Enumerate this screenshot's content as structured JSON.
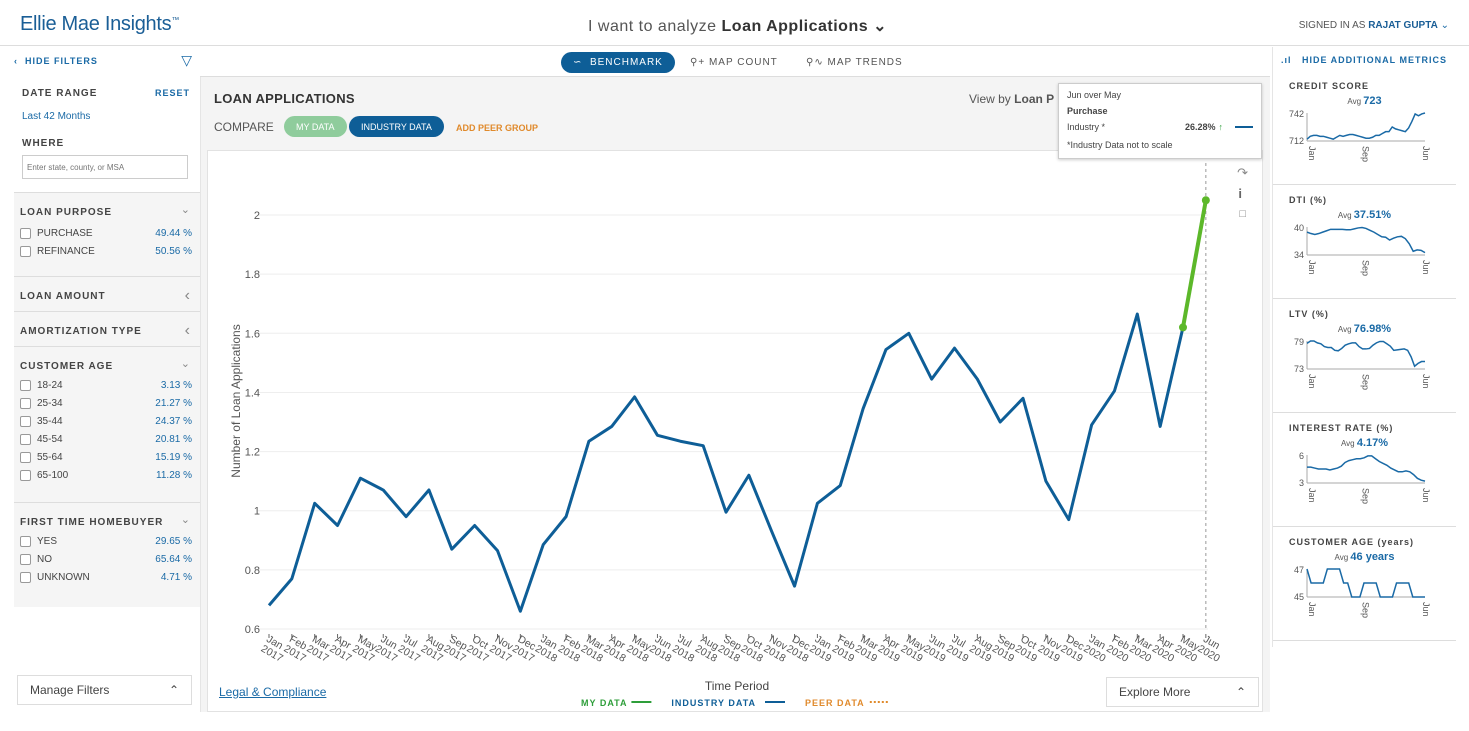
{
  "header": {
    "logo": "Ellie Mae Insights",
    "logo_tm": "™",
    "analyze_prefix": "I want to analyze",
    "analyze_subject": "Loan Applications",
    "signed_prefix": "SIGNED IN AS",
    "user": "RAJAT GUPTA"
  },
  "filters": {
    "hide": "HIDE FILTERS",
    "date_range_label": "DATE RANGE",
    "reset": "RESET",
    "date_range": "Last 42 Months",
    "where_label": "WHERE",
    "where_placeholder": "Enter state, county, or MSA",
    "loan_purpose": {
      "label": "LOAN PURPOSE",
      "items": [
        {
          "label": "PURCHASE",
          "value": "49.44 %"
        },
        {
          "label": "REFINANCE",
          "value": "50.56 %"
        }
      ]
    },
    "loan_amount": "LOAN AMOUNT",
    "amortization": "AMORTIZATION TYPE",
    "customer_age": {
      "label": "CUSTOMER AGE",
      "items": [
        {
          "label": "18-24",
          "value": "3.13 %"
        },
        {
          "label": "25-34",
          "value": "21.27 %"
        },
        {
          "label": "35-44",
          "value": "24.37 %"
        },
        {
          "label": "45-54",
          "value": "20.81 %"
        },
        {
          "label": "55-64",
          "value": "15.19 %"
        },
        {
          "label": "65-100",
          "value": "11.28 %"
        }
      ]
    },
    "first_time": {
      "label": "FIRST TIME HOMEBUYER",
      "items": [
        {
          "label": "YES",
          "value": "29.65 %"
        },
        {
          "label": "NO",
          "value": "65.64 %"
        },
        {
          "label": "UNKNOWN",
          "value": "4.71 %"
        }
      ]
    },
    "manage": "Manage Filters"
  },
  "tabs": [
    "BENCHMARK",
    "MAP COUNT",
    "MAP TRENDS"
  ],
  "main": {
    "title": "LOAN APPLICATIONS",
    "view_by": "View by",
    "view_by_value": "Loan P",
    "compare": "COMPARE",
    "my_data": "MY DATA",
    "industry_data": "INDUSTRY DATA",
    "add_peer": "ADD PEER GROUP",
    "legal": "Legal & Compliance",
    "explore": "Explore More"
  },
  "tooltip": {
    "period": "Jun over May",
    "category": "Purchase",
    "series": "Industry *",
    "change": "26.28%",
    "note": "*Industry Data not to scale"
  },
  "colors": {
    "industry": "#0e5e97",
    "my_data": "#5cb82a",
    "peer": "#e08a2c"
  },
  "chart_data": {
    "type": "line",
    "xlabel": "Time Period",
    "ylabel": "Number of Loan Applications",
    "ylim": [
      0.6,
      2.1
    ],
    "yticks": [
      0.6,
      0.8,
      1,
      1.2,
      1.4,
      1.6,
      1.8,
      2
    ],
    "grid": true,
    "legend_placement": "bottom",
    "legend": [
      {
        "name": "MY DATA",
        "style": "solid",
        "color": "#2e9e3a"
      },
      {
        "name": "INDUSTRY DATA",
        "style": "solid",
        "color": "#0e5e97"
      },
      {
        "name": "PEER DATA",
        "style": "dotted",
        "color": "#e08a2c"
      }
    ],
    "categories": [
      "Jan 2017",
      "Feb 2017",
      "Mar 2017",
      "Apr 2017",
      "May 2017",
      "Jun 2017",
      "Jul 2017",
      "Aug 2017",
      "Sep 2017",
      "Oct 2017",
      "Nov 2017",
      "Dec 2017",
      "Jan 2018",
      "Feb 2018",
      "Mar 2018",
      "Apr 2018",
      "May 2018",
      "Jun 2018",
      "Jul 2018",
      "Aug 2018",
      "Sep 2018",
      "Oct 2018",
      "Nov 2018",
      "Dec 2018",
      "Jan 2019",
      "Feb 2019",
      "Mar 2019",
      "Apr 2019",
      "May 2019",
      "Jun 2019",
      "Jul 2019",
      "Aug 2019",
      "Sep 2019",
      "Oct 2019",
      "Nov 2019",
      "Dec 2019",
      "Jan 2020",
      "Feb 2020",
      "Mar 2020",
      "Apr 2020",
      "May 2020",
      "Jun 2020"
    ],
    "series": [
      {
        "name": "INDUSTRY DATA",
        "values": [
          0.68,
          0.77,
          1.025,
          0.95,
          1.11,
          1.07,
          0.98,
          1.07,
          0.87,
          0.95,
          0.865,
          0.66,
          0.885,
          0.98,
          1.235,
          1.285,
          1.385,
          1.255,
          1.235,
          1.22,
          0.995,
          1.12,
          0.93,
          0.745,
          1.025,
          1.085,
          1.345,
          1.545,
          1.6,
          1.445,
          1.55,
          1.445,
          1.3,
          1.38,
          1.1,
          0.97,
          1.29,
          1.405,
          1.665,
          1.285,
          1.62,
          2.05
        ]
      }
    ],
    "highlight": {
      "from": "May 2020",
      "to": "Jun 2020",
      "color": "#5cb82a"
    }
  },
  "metrics": {
    "hide": "HIDE ADDITIONAL METRICS",
    "xticks": [
      "Jan",
      "Sep",
      "Jun"
    ],
    "items": [
      {
        "title": "CREDIT SCORE",
        "avg": "723",
        "ymin": 712,
        "ymax": 742,
        "values": [
          714,
          717,
          718,
          718,
          717,
          717,
          716,
          715,
          714,
          716,
          718,
          717,
          718,
          719,
          719,
          718,
          717,
          716,
          715,
          715,
          716,
          718,
          718,
          720,
          722,
          722,
          727,
          725,
          724,
          723,
          722,
          726,
          733,
          741,
          739,
          741,
          742
        ]
      },
      {
        "title": "DTI (%)",
        "avg": "37.51%",
        "ymin": 34,
        "ymax": 40,
        "values": [
          38.9,
          38.6,
          38.4,
          38.6,
          38.9,
          39.2,
          39.5,
          39.5,
          39.5,
          39.5,
          39.4,
          39.4,
          39.6,
          39.8,
          39.9,
          39.7,
          39.3,
          38.9,
          38.4,
          37.9,
          37.8,
          37.2,
          37.6,
          37.9,
          38,
          37.5,
          36.4,
          34.8,
          35.1,
          35,
          34.5
        ]
      },
      {
        "title": "LTV (%)",
        "avg": "76.98%",
        "ymin": 73,
        "ymax": 79,
        "values": [
          78.5,
          79,
          79,
          78.6,
          78.4,
          77.8,
          77.6,
          77.6,
          77,
          76.9,
          77.4,
          78.1,
          78.4,
          78.6,
          78.6,
          77.8,
          77.3,
          77.3,
          77.4,
          78.1,
          78.6,
          78.9,
          78.9,
          78.4,
          77.9,
          77,
          77.1,
          77.2,
          77.3,
          77,
          75.6,
          73.6,
          74.2,
          74.6,
          74.6
        ]
      },
      {
        "title": "INTEREST RATE (%)",
        "avg": "4.17%",
        "ymin": 3,
        "ymax": 6,
        "values": [
          4.7,
          4.7,
          4.6,
          4.5,
          4.5,
          4.5,
          4.4,
          4.5,
          4.6,
          4.8,
          5.2,
          5.4,
          5.5,
          5.6,
          5.6,
          5.7,
          5.9,
          5.9,
          5.6,
          5.3,
          5.1,
          4.9,
          4.6,
          4.4,
          4.2,
          4.2,
          4.3,
          4.2,
          3.9,
          3.5,
          3.3,
          3.2
        ]
      },
      {
        "title": "CUSTOMER AGE (years)",
        "avg": "46 years",
        "ymin": 45,
        "ymax": 47,
        "values": [
          47,
          46,
          46,
          46,
          46,
          47,
          47,
          47,
          47,
          46,
          46,
          45,
          45,
          45,
          46,
          46,
          46,
          46,
          45,
          45,
          45,
          45,
          46,
          46,
          46,
          46,
          45,
          45,
          45,
          45
        ]
      }
    ]
  }
}
